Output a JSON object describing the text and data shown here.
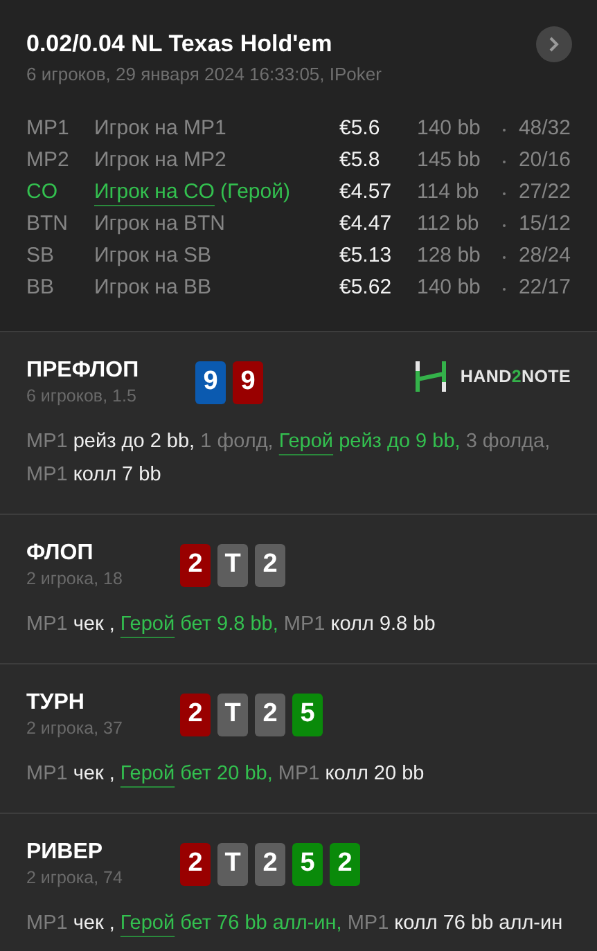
{
  "header": {
    "title": "0.02/0.04 NL Texas Hold'em",
    "subtitle": "6 игроков, 29 января 2024 16:33:05, IPoker"
  },
  "players": [
    {
      "position": "MP1",
      "name": "Игрок на MP1",
      "hero": false,
      "stack": "€5.6",
      "bb": "140 bb",
      "stats": "48/32"
    },
    {
      "position": "MP2",
      "name": "Игрок на MP2",
      "hero": false,
      "stack": "€5.8",
      "bb": "145 bb",
      "stats": "20/16"
    },
    {
      "position": "CO",
      "name": "Игрок на CO",
      "hero": true,
      "hero_tag": "(Герой)",
      "stack": "€4.57",
      "bb": "114 bb",
      "stats": "27/22"
    },
    {
      "position": "BTN",
      "name": "Игрок на BTN",
      "hero": false,
      "stack": "€4.47",
      "bb": "112 bb",
      "stats": "15/12"
    },
    {
      "position": "SB",
      "name": "Игрок на SB",
      "hero": false,
      "stack": "€5.13",
      "bb": "128 bb",
      "stats": "28/24"
    },
    {
      "position": "BB",
      "name": "Игрок на BB",
      "hero": false,
      "stack": "€5.62",
      "bb": "140 bb",
      "stats": "22/17"
    }
  ],
  "logo": {
    "parts": [
      {
        "kind": "plain",
        "text": "HAND"
      },
      {
        "kind": "accent",
        "text": "2"
      },
      {
        "kind": "plain",
        "text": "NOTE"
      }
    ]
  },
  "streets": [
    {
      "title": "ПРЕФЛОП",
      "subtitle": "6 игроков, 1.5",
      "logo": true,
      "cards": [
        {
          "rank": "9",
          "color": "#0b5ab0"
        },
        {
          "rank": "9",
          "color": "#990000"
        }
      ],
      "actions": [
        {
          "kind": "player",
          "text": "MP1"
        },
        {
          "kind": "action",
          "text": "рейз до 2 bb,"
        },
        {
          "kind": "info",
          "text": "1 фолд,"
        },
        {
          "kind": "hero",
          "text": "Герой"
        },
        {
          "kind": "hero_action",
          "text": "рейз до 9 bb,"
        },
        {
          "kind": "info",
          "text": "3 фолда,"
        },
        {
          "kind": "player",
          "text": "MP1"
        },
        {
          "kind": "action",
          "text": "колл 7 bb"
        }
      ]
    },
    {
      "title": "ФЛОП",
      "subtitle": "2 игрока, 18",
      "logo": false,
      "cards": [
        {
          "rank": "2",
          "color": "#990000"
        },
        {
          "rank": "T",
          "color": "#5e5e5e"
        },
        {
          "rank": "2",
          "color": "#5e5e5e"
        }
      ],
      "actions": [
        {
          "kind": "player",
          "text": "MP1"
        },
        {
          "kind": "action",
          "text": "чек ,"
        },
        {
          "kind": "hero",
          "text": "Герой"
        },
        {
          "kind": "hero_action",
          "text": "бет 9.8 bb,"
        },
        {
          "kind": "player",
          "text": "MP1"
        },
        {
          "kind": "action",
          "text": "колл 9.8 bb"
        }
      ]
    },
    {
      "title": "ТУРН",
      "subtitle": "2 игрока, 37",
      "logo": false,
      "cards": [
        {
          "rank": "2",
          "color": "#990000"
        },
        {
          "rank": "T",
          "color": "#5e5e5e"
        },
        {
          "rank": "2",
          "color": "#5e5e5e"
        },
        {
          "rank": "5",
          "color": "#0a8a0a"
        }
      ],
      "actions": [
        {
          "kind": "player",
          "text": "MP1"
        },
        {
          "kind": "action",
          "text": "чек ,"
        },
        {
          "kind": "hero",
          "text": "Герой"
        },
        {
          "kind": "hero_action",
          "text": "бет 20 bb,"
        },
        {
          "kind": "player",
          "text": "MP1"
        },
        {
          "kind": "action",
          "text": "колл 20 bb"
        }
      ]
    },
    {
      "title": "РИВЕР",
      "subtitle": "2 игрока, 74",
      "logo": false,
      "cards": [
        {
          "rank": "2",
          "color": "#990000"
        },
        {
          "rank": "T",
          "color": "#5e5e5e"
        },
        {
          "rank": "2",
          "color": "#5e5e5e"
        },
        {
          "rank": "5",
          "color": "#0a8a0a"
        },
        {
          "rank": "2",
          "color": "#0a8a0a"
        }
      ],
      "actions": [
        {
          "kind": "player",
          "text": "MP1"
        },
        {
          "kind": "action",
          "text": "чек ,"
        },
        {
          "kind": "hero",
          "text": "Герой"
        },
        {
          "kind": "hero_action",
          "text": "бет 76 bb алл-ин,"
        },
        {
          "kind": "player",
          "text": "MP1"
        },
        {
          "kind": "action",
          "text": "колл 76 bb алл-ин"
        }
      ]
    }
  ]
}
